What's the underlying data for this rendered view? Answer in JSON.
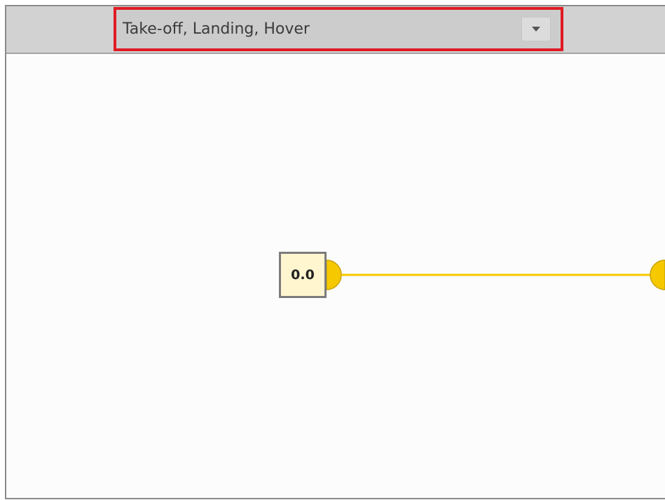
{
  "mode_selector": {
    "selected": "Take-off, Landing, Hover",
    "arrow_icon": "chevron-down-icon"
  },
  "node": {
    "value": "0.0"
  },
  "colors": {
    "highlight_border": "#e01b24",
    "connector": "#f5c800",
    "value_box_fill": "#fff6cf",
    "toolbar": "#d2d2d2"
  }
}
